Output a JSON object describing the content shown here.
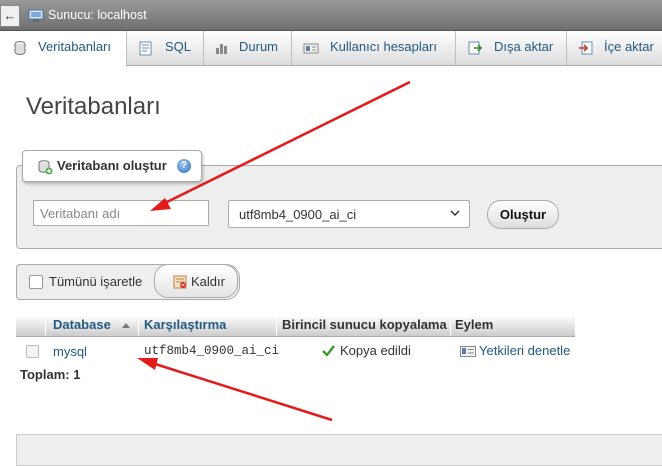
{
  "server_bar": {
    "back_glyph": "←",
    "label": "Sunucu: localhost"
  },
  "tabs": [
    {
      "label": "Veritabanları",
      "icon": "database-icon",
      "active": true
    },
    {
      "label": "SQL",
      "icon": "sql-icon"
    },
    {
      "label": "Durum",
      "icon": "status-icon"
    },
    {
      "label": "Kullanıcı hesapları",
      "icon": "users-icon"
    },
    {
      "label": "Dışa aktar",
      "icon": "export-icon"
    },
    {
      "label": "İçe aktar",
      "icon": "import-icon"
    }
  ],
  "page_title": "Veritabanları",
  "create_db": {
    "legend": "Veritabanı oluştur",
    "name_placeholder": "Veritabanı adı",
    "collation_value": "utf8mb4_0900_ai_ci",
    "button_label": "Oluştur",
    "help_glyph": "?"
  },
  "bulk": {
    "check_all_label": "Tümünü işaretle",
    "drop_label": "Kaldır"
  },
  "table": {
    "headers": [
      "Database",
      "Karşılaştırma",
      "Birincil sunucu kopyalama",
      "Eylem"
    ],
    "rows": [
      {
        "database": "mysql",
        "collation": "utf8mb4_0900_ai_ci",
        "replication": "Kopya edildi",
        "action": "Yetkileri denetle"
      }
    ],
    "total": "Toplam: 1"
  },
  "colors": {
    "link": "#235a81",
    "arrow": "#e31b1b",
    "check_green": "#3c9a2d"
  }
}
